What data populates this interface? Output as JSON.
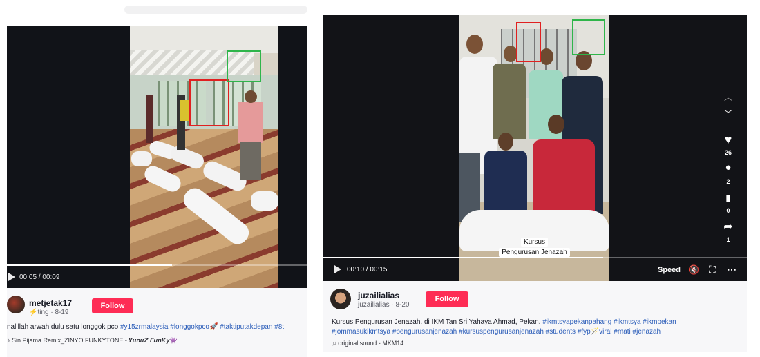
{
  "left": {
    "video": {
      "current_time": "00:05",
      "duration": "00:09",
      "progress": 0.55
    },
    "author": {
      "username": "metjetak17",
      "sub": "⚡ting · 8-19",
      "follow_label": "Follow"
    },
    "caption": {
      "text": "nalillah arwah dulu satu longgok pco ",
      "tags": [
        "#y15zrmalaysia",
        "#longgokpco🚀",
        "#taktiputakdepan",
        "#8t"
      ]
    },
    "sound": "Sin Pijama Remix_ZINYO FUNKYTONE - 𝒀𝒖𝒏𝒖𝒁 𝑭𝒖𝒏𝑲𝒚👾"
  },
  "right": {
    "video": {
      "current_time": "00:10",
      "duration": "00:15",
      "progress": 0.66,
      "overlay_line1": "Kursus",
      "overlay_line2": "Pengurusan Jenazah",
      "speed_label": "Speed"
    },
    "actions": {
      "likes": "26",
      "comments": "2",
      "saves": "0",
      "shares": "1"
    },
    "author": {
      "username": "juzailialias",
      "sub": "juzailialias · 8-20",
      "follow_label": "Follow"
    },
    "caption": {
      "text": "Kursus Pengurusan Jenazah. di IKM Tan Sri Yahaya Ahmad, Pekan. ",
      "tags_line1": [
        "#ikmtsyapekanpahang",
        "#ikmtsya",
        "#ikmpekan"
      ],
      "tags_line2": [
        "#jommasukikmtsya",
        "#pengurusanjenazah",
        "#kursuspengurusanjenazah",
        "#students",
        "#fyp🪄viral",
        "#mati",
        "#jenazah"
      ]
    },
    "sound": "original sound - MKM14"
  },
  "colors": {
    "follow": "#fe2c55",
    "hashtag": "#2b5db9",
    "highlight_red": "#e02020",
    "highlight_green": "#2fb54a"
  }
}
